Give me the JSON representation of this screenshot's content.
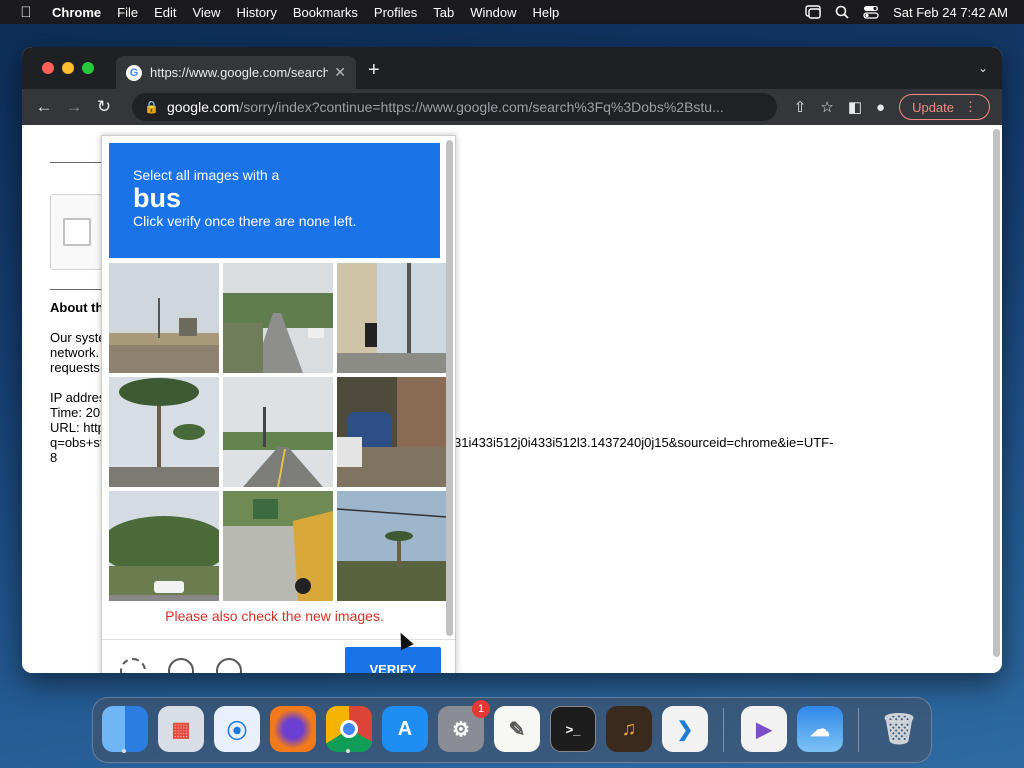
{
  "menubar": {
    "app": "Chrome",
    "menus": [
      "File",
      "Edit",
      "View",
      "History",
      "Bookmarks",
      "Profiles",
      "Tab",
      "Window",
      "Help"
    ],
    "clock": "Sat Feb 24  7:42 AM"
  },
  "browser": {
    "tab_title": "https://www.google.com/search",
    "url_host": "google.com",
    "url_path": "/sorry/index?continue=https://www.google.com/search%3Fq%3Dobs%2Bstu...",
    "update_label": "Update"
  },
  "page": {
    "about_heading": "About th",
    "para1": [
      "Our syste",
      "network.",
      "requests"
    ],
    "para2": [
      "IP addres",
      "Time: 20",
      "URL: http",
      "q=obs+st",
      "8"
    ],
    "url_tail": "31i433i512j0i433i512l3.1437240j0j15&sourceid=chrome&ie=UTF-"
  },
  "captcha": {
    "instruction_top": "Select all images with a",
    "target": "bus",
    "instruction_bottom": "Click verify once there are none left.",
    "warning": "Please also check the new images.",
    "verify_label": "VERIFY"
  },
  "dock": {
    "settings_badge": "1"
  },
  "colors": {
    "captcha_blue": "#1a73e8",
    "warning_red": "#d93025",
    "update_pink": "#f28b82"
  }
}
